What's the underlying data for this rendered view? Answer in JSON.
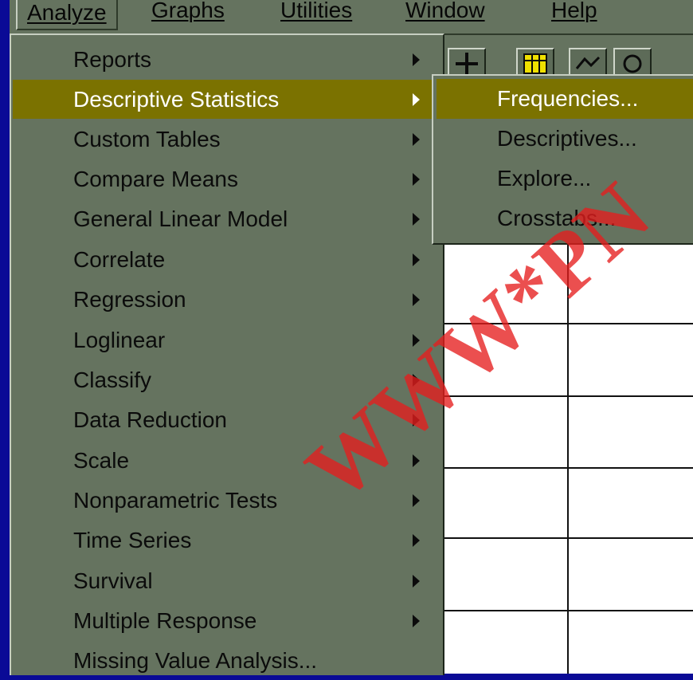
{
  "menubar": {
    "items": [
      "Analyze",
      "Graphs",
      "Utilities",
      "Window",
      "Help"
    ],
    "active": "Analyze"
  },
  "analyze_menu": {
    "items": [
      {
        "label": "Reports",
        "submenu": true
      },
      {
        "label": "Descriptive Statistics",
        "submenu": true,
        "highlighted": true
      },
      {
        "label": "Custom Tables",
        "submenu": true
      },
      {
        "label": "Compare Means",
        "submenu": true
      },
      {
        "label": "General Linear Model",
        "submenu": true
      },
      {
        "label": "Correlate",
        "submenu": true
      },
      {
        "label": "Regression",
        "submenu": true
      },
      {
        "label": "Loglinear",
        "submenu": true
      },
      {
        "label": "Classify",
        "submenu": true
      },
      {
        "label": "Data Reduction",
        "submenu": true
      },
      {
        "label": "Scale",
        "submenu": true
      },
      {
        "label": "Nonparametric Tests",
        "submenu": true
      },
      {
        "label": "Time Series",
        "submenu": true
      },
      {
        "label": "Survival",
        "submenu": true
      },
      {
        "label": "Multiple Response",
        "submenu": true
      },
      {
        "label": "Missing Value Analysis...",
        "submenu": false
      }
    ]
  },
  "descriptive_submenu": {
    "items": [
      {
        "label": "Frequencies...",
        "highlighted": true
      },
      {
        "label": "Descriptives..."
      },
      {
        "label": "Explore..."
      },
      {
        "label": "Crosstabs..."
      }
    ]
  },
  "toolbar": {
    "icons": [
      "insert-case-icon",
      "insert-variable-icon",
      "value-labels-icon",
      "use-sets-icon"
    ]
  },
  "watermark": {
    "text": "WWW*PN"
  },
  "colors": {
    "desktop": "#0a0a96",
    "menu_face": "#65735f",
    "highlight": "#7b7200",
    "highlight_text": "#ffffff",
    "watermark": "#e61e1e"
  }
}
